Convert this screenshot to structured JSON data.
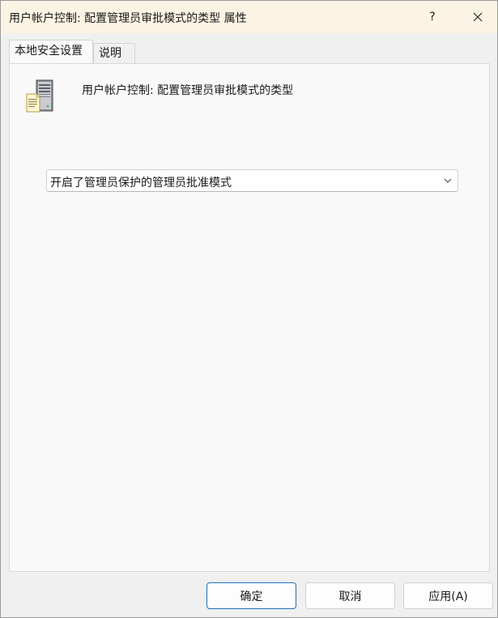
{
  "window": {
    "title": "用户帐户控制:  配置管理员审批模式的类型 属性",
    "help_label": "?",
    "close_icon": "close-icon"
  },
  "tabs": [
    {
      "label": "本地安全设置",
      "active": true
    },
    {
      "label": "说明",
      "active": false
    }
  ],
  "policy": {
    "icon": "server-policy-icon",
    "name": "用户帐户控制:  配置管理员审批模式的类型"
  },
  "setting": {
    "selected": "开启了管理员保护的管理员批准模式"
  },
  "buttons": {
    "ok": "确定",
    "cancel": "取消",
    "apply": "应用(A)"
  },
  "colors": {
    "titlebar": "#fbf3e3",
    "default_button_border": "#1f6fb5"
  }
}
